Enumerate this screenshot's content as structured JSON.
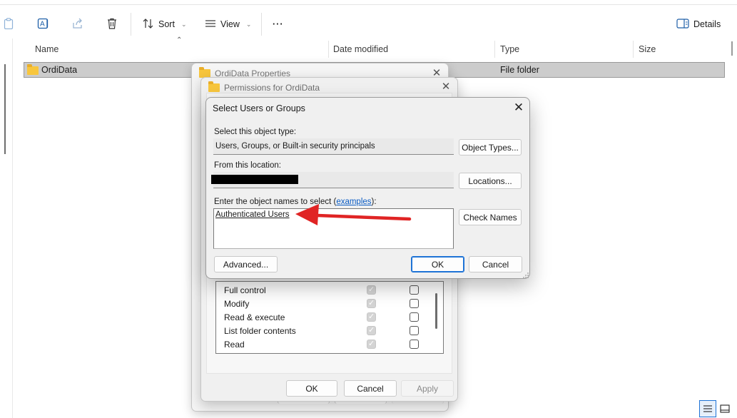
{
  "toolbar": {
    "sort_label": "Sort",
    "view_label": "View",
    "more_label": "···",
    "details_label": "Details",
    "icons": [
      "clipboard-icon",
      "rename-icon",
      "share-icon",
      "delete-icon",
      "sort-icon",
      "view-icon",
      "more-icon",
      "details-pane-icon"
    ]
  },
  "columns": [
    {
      "label": "Name"
    },
    {
      "label": "Date modified"
    },
    {
      "label": "Type"
    },
    {
      "label": "Size"
    }
  ],
  "files": [
    {
      "name": "OrdiData",
      "date": "",
      "type": "File folder",
      "size": "",
      "selected": true
    }
  ],
  "properties_window": {
    "title": "OrdiData Properties",
    "buttons": {
      "ok": "OK",
      "cancel": "Cancel",
      "apply": "Apply"
    }
  },
  "permissions_window": {
    "title": "Permissions for OrdiData",
    "permissions": [
      {
        "name": "Full control",
        "allow": true,
        "deny": false
      },
      {
        "name": "Modify",
        "allow": true,
        "deny": false
      },
      {
        "name": "Read & execute",
        "allow": true,
        "deny": false
      },
      {
        "name": "List folder contents",
        "allow": true,
        "deny": false
      },
      {
        "name": "Read",
        "allow": true,
        "deny": false
      }
    ],
    "buttons": {
      "ok": "OK",
      "cancel": "Cancel",
      "apply": "Apply"
    }
  },
  "select_dialog": {
    "title": "Select Users or Groups",
    "object_type_label": "Select this object type:",
    "object_type_value": "Users, Groups, or Built-in security principals",
    "object_types_button": "Object Types...",
    "location_label": "From this location:",
    "locations_button": "Locations...",
    "names_label_prefix": "Enter the object names to select (",
    "names_label_link": "examples",
    "names_label_suffix": "):",
    "names_value": "Authenticated Users",
    "check_names_button": "Check Names",
    "advanced_button": "Advanced...",
    "ok_button": "OK",
    "cancel_button": "Cancel"
  },
  "colors": {
    "accent": "#1e73d6",
    "folder": "#f8c63d",
    "annotation_arrow": "#e02424",
    "selection": "#cccccc"
  }
}
